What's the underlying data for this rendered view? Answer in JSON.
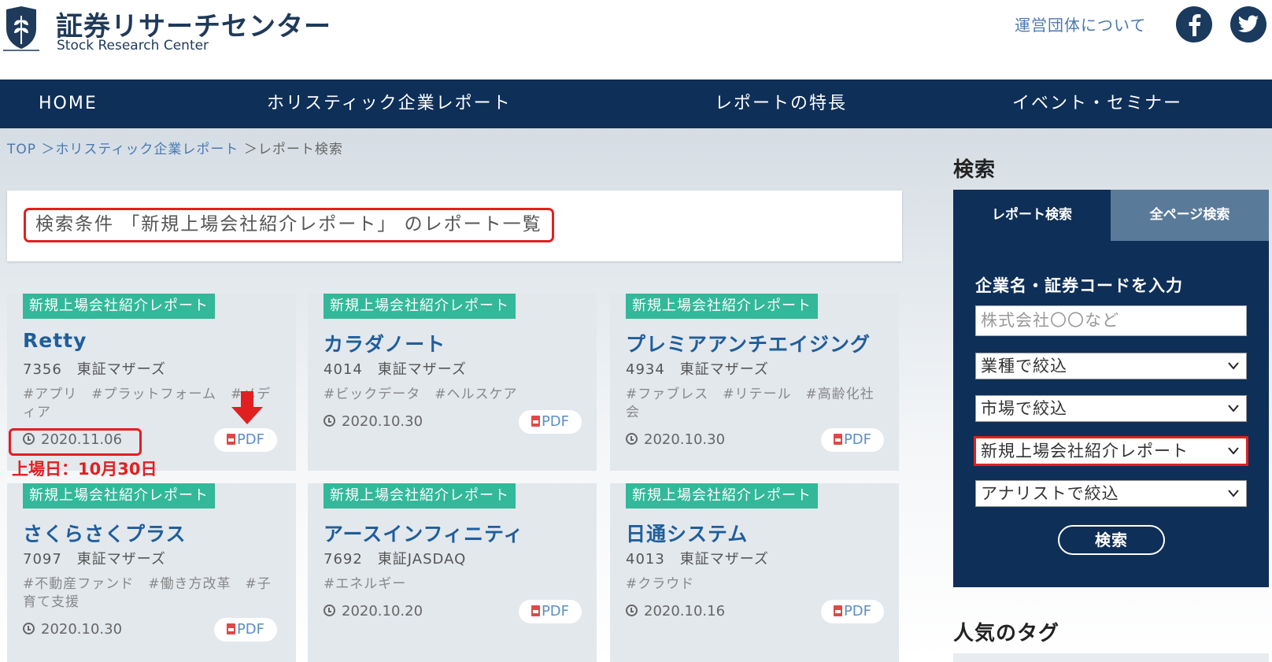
{
  "header": {
    "site_title": "証券リサーチセンター",
    "site_subtitle": "Stock Research Center",
    "about_link": "運営団体について",
    "facebook_icon": "facebook-icon",
    "twitter_icon": "twitter-icon"
  },
  "nav": {
    "items": [
      {
        "label": "HOME"
      },
      {
        "label": "ホリスティック企業レポート"
      },
      {
        "label": "レポートの特長"
      },
      {
        "label": "イベント・セミナー"
      }
    ]
  },
  "breadcrumb": {
    "top": "TOP",
    "sep1": " ＞",
    "mid": "ホリスティック企業レポート",
    "sep2": " ＞",
    "current": "レポート検索"
  },
  "search_heading": "検索条件 「新規上場会社紹介レポート」 のレポート一覧",
  "cards": [
    {
      "category": "新規上場会社紹介レポート",
      "name": "Retty",
      "meta": "7356　東証マザーズ",
      "tags": "#アプリ　#プラットフォーム　#メディア",
      "date": "2020.11.06",
      "pdf": "PDF"
    },
    {
      "category": "新規上場会社紹介レポート",
      "name": "カラダノート",
      "meta": "4014　東証マザーズ",
      "tags": "#ビックデータ　#ヘルスケア",
      "date": "2020.10.30",
      "pdf": "PDF"
    },
    {
      "category": "新規上場会社紹介レポート",
      "name": "プレミアアンチエイジング",
      "meta": "4934　東証マザーズ",
      "tags": "#ファブレス　#リテール　#高齢化社会",
      "date": "2020.10.30",
      "pdf": "PDF"
    },
    {
      "category": "新規上場会社紹介レポート",
      "name": "さくらさくプラス",
      "meta": "7097　東証マザーズ",
      "tags": "#不動産ファンド　#働き方改革　#子育て支援",
      "date": "2020.10.30",
      "pdf": "PDF"
    },
    {
      "category": "新規上場会社紹介レポート",
      "name": "アースインフィニティ",
      "meta": "7692　東証JASDAQ",
      "tags": "#エネルギー",
      "date": "2020.10.20",
      "pdf": "PDF"
    },
    {
      "category": "新規上場会社紹介レポート",
      "name": "日通システム",
      "meta": "4013　東証マザーズ",
      "tags": "#クラウド",
      "date": "2020.10.16",
      "pdf": "PDF"
    }
  ],
  "annotation": {
    "listing_date": "上場日：10月30日",
    "accent": "#e02020"
  },
  "sidebar": {
    "title": "検索",
    "tab_report": "レポート検索",
    "tab_all": "全ページ検索",
    "input_label": "企業名・証券コードを入力",
    "input_placeholder": "株式会社〇〇など",
    "select_industry": "業種で絞込",
    "select_market": "市場で絞込",
    "select_category": "新規上場会社紹介レポート",
    "select_analyst": "アナリストで絞込",
    "search_button": "検索",
    "popular_tags": "人気のタグ"
  },
  "colors": {
    "nav_bg": "#0e2f58",
    "tag_green": "#33b89a",
    "link_blue": "#1f5e9c"
  }
}
